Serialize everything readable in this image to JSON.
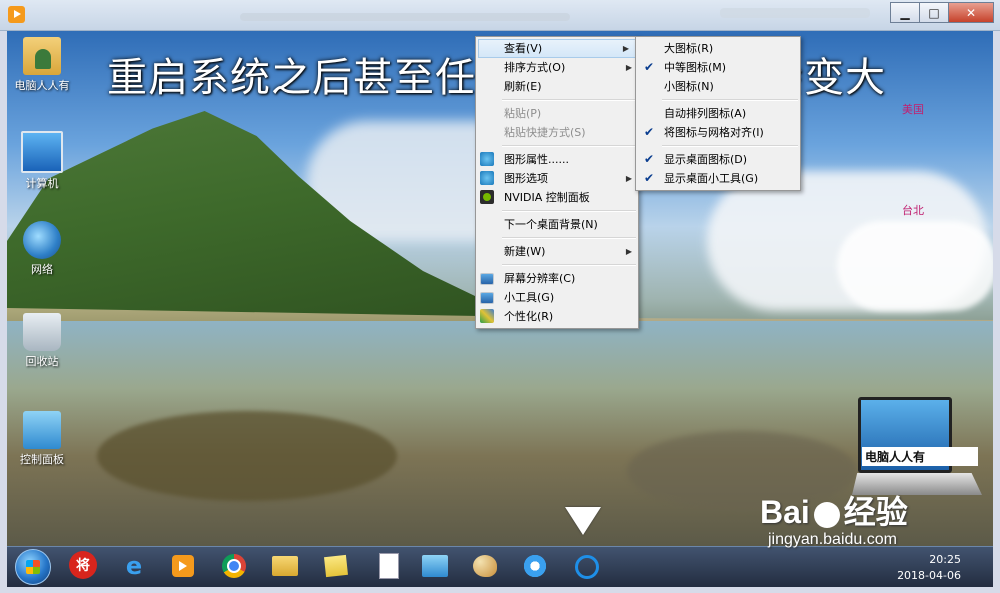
{
  "overlay_caption": "重启系统之后甚至任务栏的有的标也会变大",
  "desktop_labels": {
    "usa": "美国",
    "taipei": "台北"
  },
  "desktop_icons": [
    {
      "label": "电脑人人有",
      "icon": "user-folder-icon"
    },
    {
      "label": "计算机",
      "icon": "computer-icon"
    },
    {
      "label": "网络",
      "icon": "network-icon"
    },
    {
      "label": "回收站",
      "icon": "recycle-bin-icon"
    },
    {
      "label": "控制面板",
      "icon": "control-panel-icon"
    }
  ],
  "context_menu": {
    "items": [
      {
        "label": "查看(V)",
        "submenu": true,
        "highlighted": true
      },
      {
        "label": "排序方式(O)",
        "submenu": true
      },
      {
        "label": "刷新(E)"
      },
      {
        "separator": true
      },
      {
        "label": "粘贴(P)",
        "disabled": true
      },
      {
        "label": "粘贴快捷方式(S)",
        "disabled": true
      },
      {
        "separator": true
      },
      {
        "label": "图形属性......",
        "icon": "graphics-icon"
      },
      {
        "label": "图形选项",
        "icon": "graphics-icon",
        "submenu": true
      },
      {
        "label": "NVIDIA 控制面板",
        "icon": "nvidia-icon"
      },
      {
        "separator": true
      },
      {
        "label": "下一个桌面背景(N)"
      },
      {
        "separator": true
      },
      {
        "label": "新建(W)",
        "submenu": true
      },
      {
        "separator": true
      },
      {
        "label": "屏幕分辨率(C)",
        "icon": "monitor-icon"
      },
      {
        "label": "小工具(G)",
        "icon": "gadgets-icon"
      },
      {
        "label": "个性化(R)",
        "icon": "personalize-icon"
      }
    ]
  },
  "view_submenu": {
    "items": [
      {
        "label": "大图标(R)"
      },
      {
        "label": "中等图标(M)",
        "checked": true
      },
      {
        "label": "小图标(N)"
      },
      {
        "separator": true
      },
      {
        "label": "自动排列图标(A)"
      },
      {
        "label": "将图标与网格对齐(I)",
        "checked": true
      },
      {
        "separator": true
      },
      {
        "label": "显示桌面图标(D)",
        "checked": true
      },
      {
        "label": "显示桌面小工具(G)",
        "checked": true
      }
    ]
  },
  "logo": {
    "text": "电脑人人有"
  },
  "watermark": {
    "brand": "Bai",
    "brand2": "经验",
    "url": "jingyan.baidu.com"
  },
  "tray": {
    "time": "20:25",
    "date": "2018-04-06"
  },
  "taskbar": {
    "jiang_label": "将",
    "ie_label": "e"
  },
  "window": {
    "minimize": "▁",
    "maximize": "□",
    "close": "✕"
  }
}
